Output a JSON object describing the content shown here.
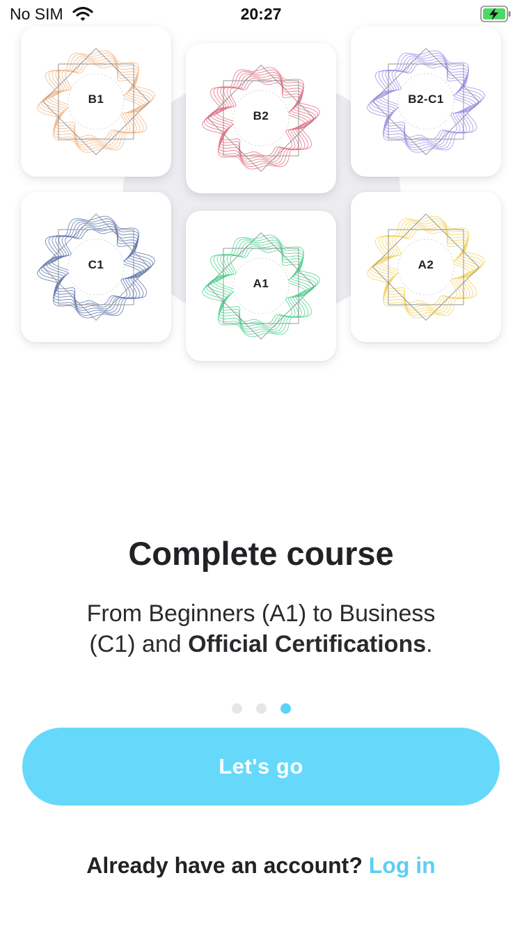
{
  "status_bar": {
    "carrier": "No SIM",
    "time": "20:27"
  },
  "certificates": [
    {
      "level": "B1",
      "color": "#f2b27a"
    },
    {
      "level": "B2",
      "color": "#e36278"
    },
    {
      "level": "B2-C1",
      "color": "#9a86e6"
    },
    {
      "level": "C1",
      "color": "#4e6aa8"
    },
    {
      "level": "A1",
      "color": "#3fcf86"
    },
    {
      "level": "A2",
      "color": "#f1cf52"
    }
  ],
  "onboarding": {
    "title": "Complete course",
    "subtitle_plain": "From Beginners (A1) to Business (C1) and ",
    "subtitle_bold": "Official Certifications",
    "subtitle_end": ".",
    "page_count": 3,
    "active_page": 3
  },
  "actions": {
    "primary_label": "Let's go",
    "account_prompt": "Already have an account?",
    "login_label": "Log in"
  },
  "colors": {
    "accent": "#66d9fa",
    "link": "#5ccff2",
    "battery": "#4cd964"
  }
}
